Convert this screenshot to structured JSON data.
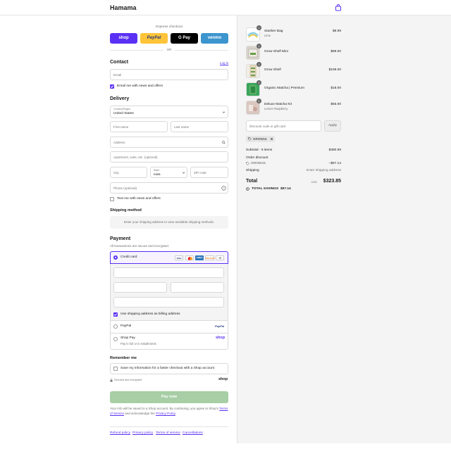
{
  "header": {
    "brand": "Hamama",
    "cart_icon": "bag-icon"
  },
  "express": {
    "label": "Express checkout",
    "shop": "shop",
    "paypal": "PayPal",
    "gpay": "G Pay",
    "venmo": "venmo",
    "or": "OR"
  },
  "contact": {
    "title": "Contact",
    "login": "Log in",
    "email_placeholder": "Email",
    "email_news": "Email me with news and offers"
  },
  "delivery": {
    "title": "Delivery",
    "country_label": "Country/Region",
    "country_value": "United States",
    "first_name": "First name",
    "last_name": "Last name",
    "address": "Address",
    "apartment": "Apartment, suite, etc. (optional)",
    "city": "City",
    "state_label": "State",
    "state_value": "Iowa",
    "zip": "ZIP code",
    "phone": "Phone (optional)",
    "text_news": "Text me with news and offers"
  },
  "shipping": {
    "title": "Shipping method",
    "note": "Enter your shipping address to view available shipping methods."
  },
  "payment": {
    "title": "Payment",
    "subtitle": "All transactions are secure and encrypted.",
    "credit_card": "Credit card",
    "cards": [
      "VISA",
      "MC",
      "AMEX",
      "DISCOVER"
    ],
    "more_cards": "+6",
    "billing_same": "Use shipping address as billing address",
    "paypal": "PayPal",
    "paypal_logo": "PayPal",
    "shop_pay": "Shop Pay",
    "shop_pay_sub": "Pay in full or in installments",
    "shop_logo": "shop"
  },
  "remember": {
    "title": "Remember me",
    "save_info": "Save my information for a faster checkout with a Shop account",
    "secure": "Secured and encrypted",
    "shop_logo": "shop"
  },
  "pay_now": "Pay now",
  "legal": {
    "text1": "Your info will be saved to a Shop account. By continuing, you agree to Shop's",
    "terms": "Terms of Service",
    "text2": "and acknowledge the",
    "privacy": "Privacy Policy",
    "text3": "."
  },
  "footer": {
    "links": [
      "Refund policy",
      "Privacy policy",
      "Terms of service",
      "Cancellations"
    ]
  },
  "cart": {
    "items": [
      {
        "name": "Stasher Bag",
        "sub": "Lime",
        "price": "$9.99",
        "qty": "1",
        "color": "#cfe8f0"
      },
      {
        "name": "Grow Shelf Mini",
        "sub": "",
        "price": "$89.00",
        "qty": "1",
        "color": "#d8d2c8"
      },
      {
        "name": "Grow Shelf",
        "sub": "",
        "price": "$199.00",
        "qty": "1",
        "color": "#e6dccb"
      },
      {
        "name": "Organic Matcha | Premium",
        "sub": "",
        "price": "$18.00",
        "qty": "1",
        "color": "#3aa55a"
      },
      {
        "name": "Deluxe Matcha Kit",
        "sub": "Lemon Raspberry",
        "price": "$55.00",
        "qty": "1",
        "color": "#d9c7c0"
      }
    ],
    "discount_placeholder": "Discount code or gift card",
    "apply": "Apply",
    "code_chip": "GROW15",
    "subtotal_label": "Subtotal · 5 items",
    "subtotal_value": "$380.99",
    "order_discount": "Order discount",
    "discount_code": "GROW15",
    "discount_value": "−$57.14",
    "shipping_label": "Shipping",
    "shipping_value": "Enter shipping address",
    "total_label": "Total",
    "currency": "USD",
    "total_value": "$323.85",
    "savings_label": "TOTAL SAVINGS",
    "savings_value": "$57.14"
  }
}
